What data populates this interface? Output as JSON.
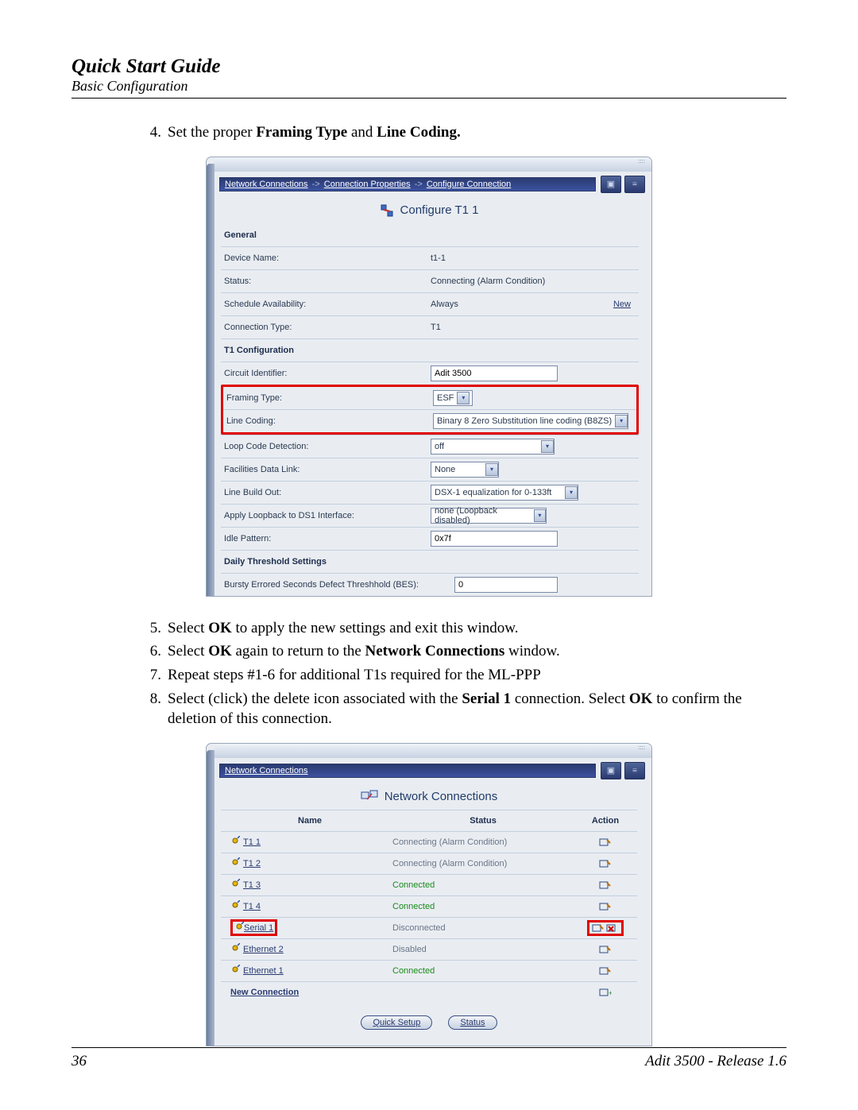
{
  "header": {
    "title": "Quick Start Guide",
    "section": "Basic Configuration"
  },
  "step4": {
    "number": "4.",
    "prefix": "Set the proper ",
    "bold1": "Framing Type",
    "mid": " and ",
    "bold2": "Line Coding."
  },
  "shot1": {
    "breadcrumb": {
      "p1": "Network Connections",
      "p2": "Connection Properties",
      "p3": "Configure Connection"
    },
    "title": "Configure T1 1",
    "sections": {
      "general": "General",
      "t1config": "T1 Configuration",
      "daily": "Daily Threshold Settings"
    },
    "rows": {
      "device_name": {
        "label": "Device Name:",
        "value": "t1-1"
      },
      "status": {
        "label": "Status:",
        "value": "Connecting (Alarm Condition)"
      },
      "schedule": {
        "label": "Schedule Availability:",
        "value": "Always",
        "link": "New"
      },
      "conn_type": {
        "label": "Connection Type:",
        "value": "T1"
      },
      "circuit_id": {
        "label": "Circuit Identifier:",
        "value": "Adit 3500"
      },
      "framing": {
        "label": "Framing Type:",
        "value": "ESF"
      },
      "coding": {
        "label": "Line Coding:",
        "value": "Binary 8 Zero Substitution line coding (B8ZS)"
      },
      "loop_code": {
        "label": "Loop Code Detection:",
        "value": "off"
      },
      "facilities": {
        "label": "Facilities Data Link:",
        "value": "None"
      },
      "line_build": {
        "label": "Line Build Out:",
        "value": "DSX-1 equalization for 0-133ft"
      },
      "loopback": {
        "label": "Apply Loopback to DS1 Interface:",
        "value": "none (Loopback disabled)"
      },
      "idle": {
        "label": "Idle Pattern:",
        "value": "0x7f"
      },
      "bes": {
        "label": "Bursty Errored Seconds Defect Threshhold (BES):",
        "value": "0"
      }
    }
  },
  "steps_after": [
    {
      "num": "5.",
      "pre": "Select ",
      "b1": "OK",
      "post": " to apply the new settings and exit this window."
    },
    {
      "num": "6.",
      "pre": "Select ",
      "b1": "OK",
      "mid": " again to return to the ",
      "b2": "Network Connections",
      "post": " window."
    },
    {
      "num": "7.",
      "pre": "Repeat steps #1-6 for additional T1s required for the ML-PPP"
    },
    {
      "num": "8.",
      "pre": "Select (click) the delete icon associated with the ",
      "b1": "Serial 1",
      "mid": " connection. Select ",
      "b2": "OK",
      "post": " to confirm the deletion of this connection."
    }
  ],
  "shot2": {
    "breadcrumb": "Network Connections",
    "title": "Network Connections",
    "columns": {
      "name": "Name",
      "status": "Status",
      "action": "Action"
    },
    "rows": [
      {
        "name": "T1 1",
        "status": "Connecting (Alarm Condition)",
        "status_class": "status-gray",
        "highlight": false
      },
      {
        "name": "T1 2",
        "status": "Connecting (Alarm Condition)",
        "status_class": "status-gray",
        "highlight": false
      },
      {
        "name": "T1 3",
        "status": "Connected",
        "status_class": "status-green",
        "highlight": false
      },
      {
        "name": "T1 4",
        "status": "Connected",
        "status_class": "status-green",
        "highlight": false
      },
      {
        "name": "Serial 1",
        "status": "Disconnected",
        "status_class": "status-gray",
        "highlight": true
      },
      {
        "name": "Ethernet 2",
        "status": "Disabled",
        "status_class": "status-gray",
        "highlight": false
      },
      {
        "name": "Ethernet 1",
        "status": "Connected",
        "status_class": "status-green",
        "highlight": false
      }
    ],
    "new_connection": "New Connection",
    "buttons": {
      "quick_setup": "Quick Setup",
      "status": "Status"
    }
  },
  "footer": {
    "page": "36",
    "product": "Adit 3500  -  Release 1.6"
  }
}
